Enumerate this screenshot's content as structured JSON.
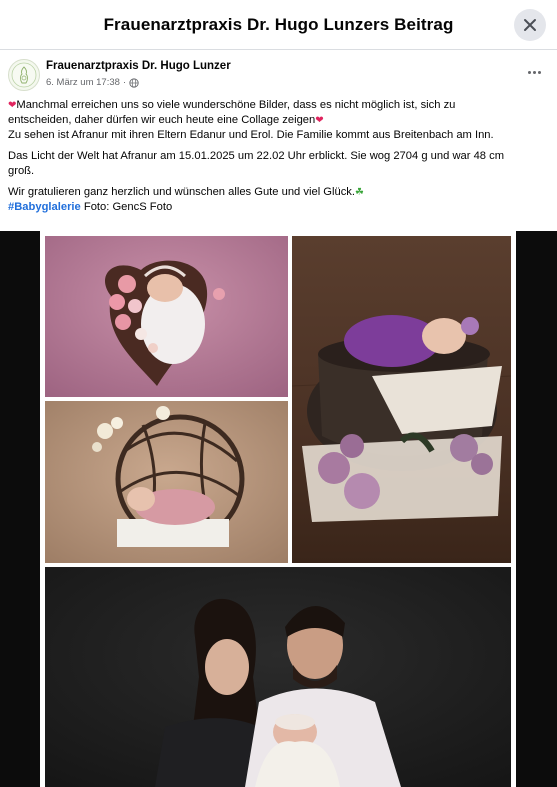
{
  "modal": {
    "title": "Frauenarztpraxis Dr. Hugo Lunzers Beitrag",
    "close_icon": "close-icon"
  },
  "post": {
    "author": "Frauenarztpraxis Dr. Hugo Lunzer",
    "date": "6. März um 17:38",
    "separator": "·",
    "privacy_icon": "globe-icon",
    "more_icon": "more-icon",
    "paragraph1_line1": "Manchmal erreichen uns so viele wunderschöne Bilder, dass es nicht möglich ist, sich zu",
    "paragraph1_line2": "entscheiden, daher dürfen wir euch heute eine Collage zeigen",
    "paragraph1_line3": "Zu sehen ist Afranur mit ihren Eltern Edanur und Erol. Die Familie kommt aus Breitenbach am Inn.",
    "paragraph2_line1": "Das Licht der Welt hat Afranur am 15.01.2025 um 22.02 Uhr erblickt. Sie wog 2704 g und war 48 cm",
    "paragraph2_line2": "groß.",
    "paragraph3": "Wir gratulieren ganz herzlich und wünschen alles Gute und viel Glück.",
    "hashtag": "#Babyglalerie",
    "photo_credit": " Foto: GencS Foto",
    "heart_glyph": "❤",
    "clover_glyph": "☘"
  },
  "colors": {
    "accent_link": "#216fdb",
    "heart": "#e0245e",
    "clover": "#3aa53a",
    "meta_text": "#65676b",
    "close_bg": "#e4e6eb",
    "collage_bg": "#0c0c0c"
  },
  "collage": {
    "photos": [
      {
        "name": "photo-baby-heart-bowl",
        "description_icon": "newborn-photo"
      },
      {
        "name": "photo-baby-basket",
        "description_icon": "newborn-photo"
      },
      {
        "name": "photo-baby-wicker-sphere",
        "description_icon": "newborn-photo"
      },
      {
        "name": "photo-family-portrait",
        "description_icon": "family-photo"
      }
    ]
  }
}
